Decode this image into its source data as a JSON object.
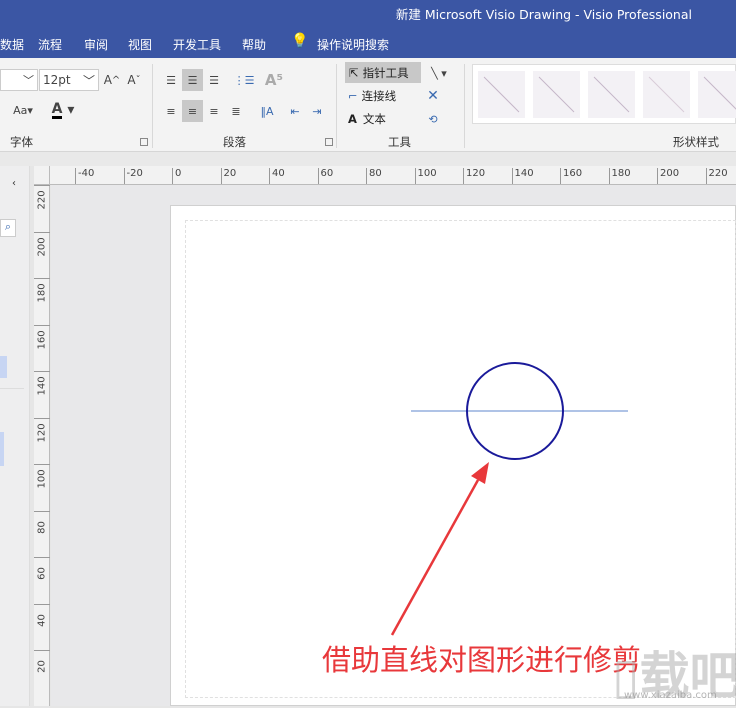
{
  "window": {
    "title": "新建 Microsoft Visio Drawing  -  Visio Professional"
  },
  "menu": {
    "items": [
      "数据",
      "流程",
      "审阅",
      "视图",
      "开发工具",
      "帮助"
    ],
    "search": "操作说明搜索"
  },
  "ribbon": {
    "font": {
      "size": "12pt",
      "case": "Aa",
      "label": "字体"
    },
    "paragraph": {
      "label": "段落"
    },
    "tools": {
      "pointer": "指针工具",
      "connector": "连接线",
      "text": "文本",
      "text_icon": "A",
      "label": "工具"
    },
    "shape_styles": {
      "label": "形状样式"
    }
  },
  "rulers": {
    "h_ticks": [
      "-40",
      "-20",
      "0",
      "20",
      "40",
      "60",
      "80",
      "100",
      "120",
      "140",
      "160",
      "180",
      "200",
      "220"
    ],
    "v_ticks": [
      "220",
      "200",
      "180",
      "160",
      "140",
      "120",
      "100",
      "80",
      "60",
      "40",
      "20"
    ]
  },
  "annotation": {
    "text": "借助直线对图形进行修剪",
    "color": "#e8383b"
  },
  "watermark": {
    "logo": "下载吧",
    "url": "www.xiazaiba.com"
  },
  "colors": {
    "brand": "#3b56a4",
    "circle": "#1a1a9a",
    "line": "#7f9fd6"
  }
}
